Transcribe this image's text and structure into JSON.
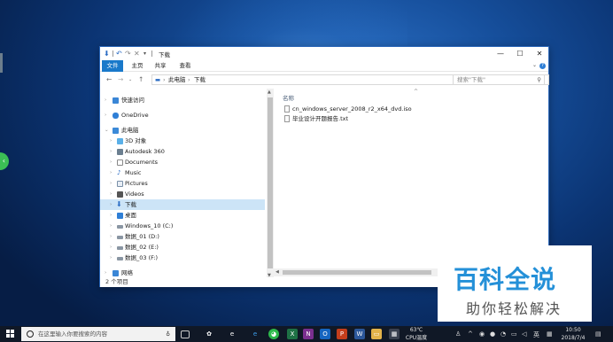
{
  "window": {
    "title": "下载",
    "qa_icons": [
      "download-icon",
      "undo-icon",
      "redo-icon",
      "delete-icon"
    ],
    "ribbon_tabs": [
      "文件",
      "主页",
      "共享",
      "查看"
    ],
    "help": "?"
  },
  "address": {
    "segments": [
      "此电脑",
      "下载"
    ],
    "search_placeholder": "搜索\"下载\""
  },
  "nav": {
    "items": [
      {
        "label": "快速访问",
        "icon": "star-icon"
      },
      {
        "label": "OneDrive",
        "icon": "cloud-icon"
      },
      {
        "label": "此电脑",
        "icon": "pc-icon"
      },
      {
        "label": "3D 对象",
        "icon": "cube-icon"
      },
      {
        "label": "Autodesk 360",
        "icon": "autodesk-icon"
      },
      {
        "label": "Documents",
        "icon": "document-icon"
      },
      {
        "label": "Music",
        "icon": "music-icon"
      },
      {
        "label": "Pictures",
        "icon": "picture-icon"
      },
      {
        "label": "Videos",
        "icon": "video-icon"
      },
      {
        "label": "下载",
        "icon": "download-icon"
      },
      {
        "label": "桌面",
        "icon": "desktop-icon"
      },
      {
        "label": "Windows_10 (C:)",
        "icon": "drive-icon"
      },
      {
        "label": "数据_01 (D:)",
        "icon": "drive-icon"
      },
      {
        "label": "数据_02 (E:)",
        "icon": "drive-icon"
      },
      {
        "label": "数据_03 (F:)",
        "icon": "drive-icon"
      },
      {
        "label": "网络",
        "icon": "network-icon"
      }
    ]
  },
  "content": {
    "column_header": "名称",
    "files": [
      "cn_windows_server_2008_r2_x64_dvd.iso",
      "毕业设计开题报告.txt"
    ]
  },
  "status": "2 个项目",
  "watermark": {
    "main": "百科全说",
    "sub": "助你轻松解决"
  },
  "taskbar": {
    "search_placeholder": "在这里输入你要搜索的内容",
    "temperature": "63℃",
    "cpu_label": "CPU温度",
    "ime": "英",
    "time": "10:50",
    "date": "2018/7/4"
  },
  "colors": {
    "accent": "#1979ca",
    "selected": "#cce4f7",
    "watermark": "#2490d8"
  }
}
